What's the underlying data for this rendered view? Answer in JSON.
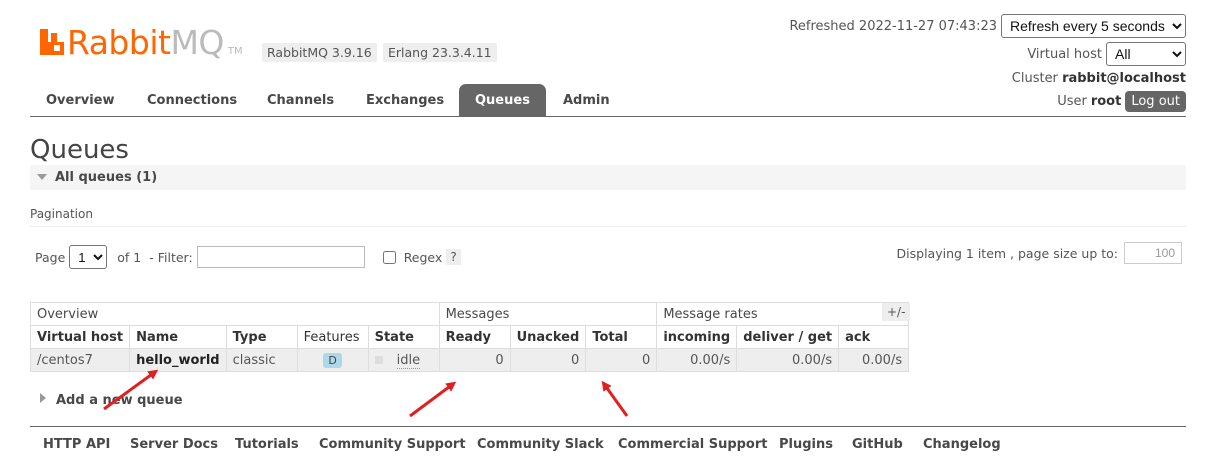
{
  "header": {
    "logo_rabbit": "Rabbit",
    "logo_mq": "MQ",
    "logo_tm": "TM",
    "version_rabbitmq": "RabbitMQ 3.9.16",
    "version_erlang": "Erlang 23.3.4.11",
    "refreshed_label": "Refreshed 2022-11-27 07:43:23",
    "refresh_select": "Refresh every 5 seconds",
    "virtual_host_label": "Virtual host",
    "virtual_host_select": "All",
    "cluster_label": "Cluster",
    "cluster_value": "rabbit@localhost",
    "user_label": "User",
    "user_value": "root",
    "logout_label": "Log out"
  },
  "tabs": [
    {
      "label": "Overview"
    },
    {
      "label": "Connections"
    },
    {
      "label": "Channels"
    },
    {
      "label": "Exchanges"
    },
    {
      "label": "Queues",
      "active": true
    },
    {
      "label": "Admin"
    }
  ],
  "page": {
    "title": "Queues",
    "section_label": "All queues (1)",
    "pagination_heading": "Pagination",
    "page_label": "Page",
    "page_select": "1",
    "of_label": "of 1",
    "filter_label": "- Filter:",
    "filter_value": "",
    "regex_label": "Regex",
    "help_label": "?",
    "displaying_label": "Displaying 1 item , page size up to:",
    "page_size_value": "100",
    "plus_minus": "+/-",
    "add_queue_label": "Add a new queue"
  },
  "table": {
    "groups": [
      "Overview",
      "Messages",
      "Message rates"
    ],
    "columns": [
      "Virtual host",
      "Name",
      "Type",
      "Features",
      "State",
      "Ready",
      "Unacked",
      "Total",
      "incoming",
      "deliver / get",
      "ack"
    ],
    "rows": [
      {
        "vhost": "/centos7",
        "name": "hello_world",
        "type": "classic",
        "feature": "D",
        "state": "idle",
        "ready": "0",
        "unacked": "0",
        "total": "0",
        "incoming": "0.00/s",
        "deliver_get": "0.00/s",
        "ack": "0.00/s"
      }
    ]
  },
  "footer": {
    "links": [
      "HTTP API",
      "Server Docs",
      "Tutorials",
      "Community Support",
      "Community Slack",
      "Commercial Support",
      "Plugins",
      "GitHub",
      "Changelog"
    ]
  },
  "colors": {
    "brand": "#ff6600",
    "tab_active": "#666666",
    "annotation_arrow": "#e02020",
    "feature_badge": "#add8e6"
  }
}
